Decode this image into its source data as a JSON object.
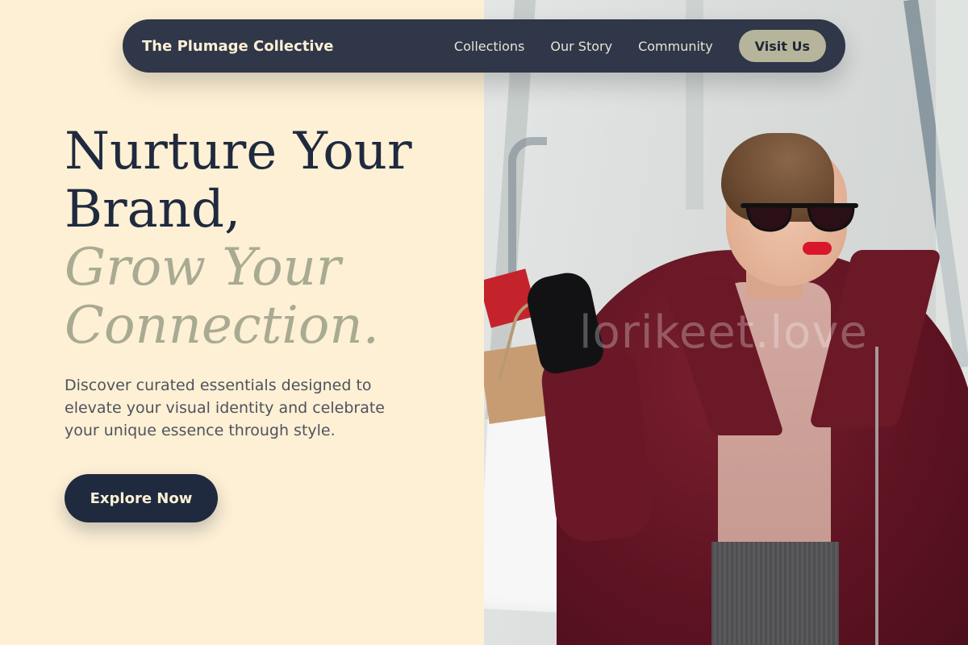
{
  "nav": {
    "brand": "The Plumage Collective",
    "links": [
      {
        "label": "Collections"
      },
      {
        "label": "Our Story"
      },
      {
        "label": "Community"
      }
    ],
    "cta_label": "Visit Us"
  },
  "hero": {
    "headline_primary": "Nurture Your Brand,",
    "headline_secondary": "Grow Your Connection.",
    "subtext": "Discover curated essentials designed to elevate your visual identity and celebrate your unique essence through style.",
    "cta_label": "Explore Now",
    "image_watermark": "lorikeet.love"
  },
  "colors": {
    "background": "#fdf0d5",
    "navbar": "#2f3748",
    "navy": "#1f2a3f",
    "sage": "#a9aa92",
    "visit_button": "#b6b59c"
  }
}
